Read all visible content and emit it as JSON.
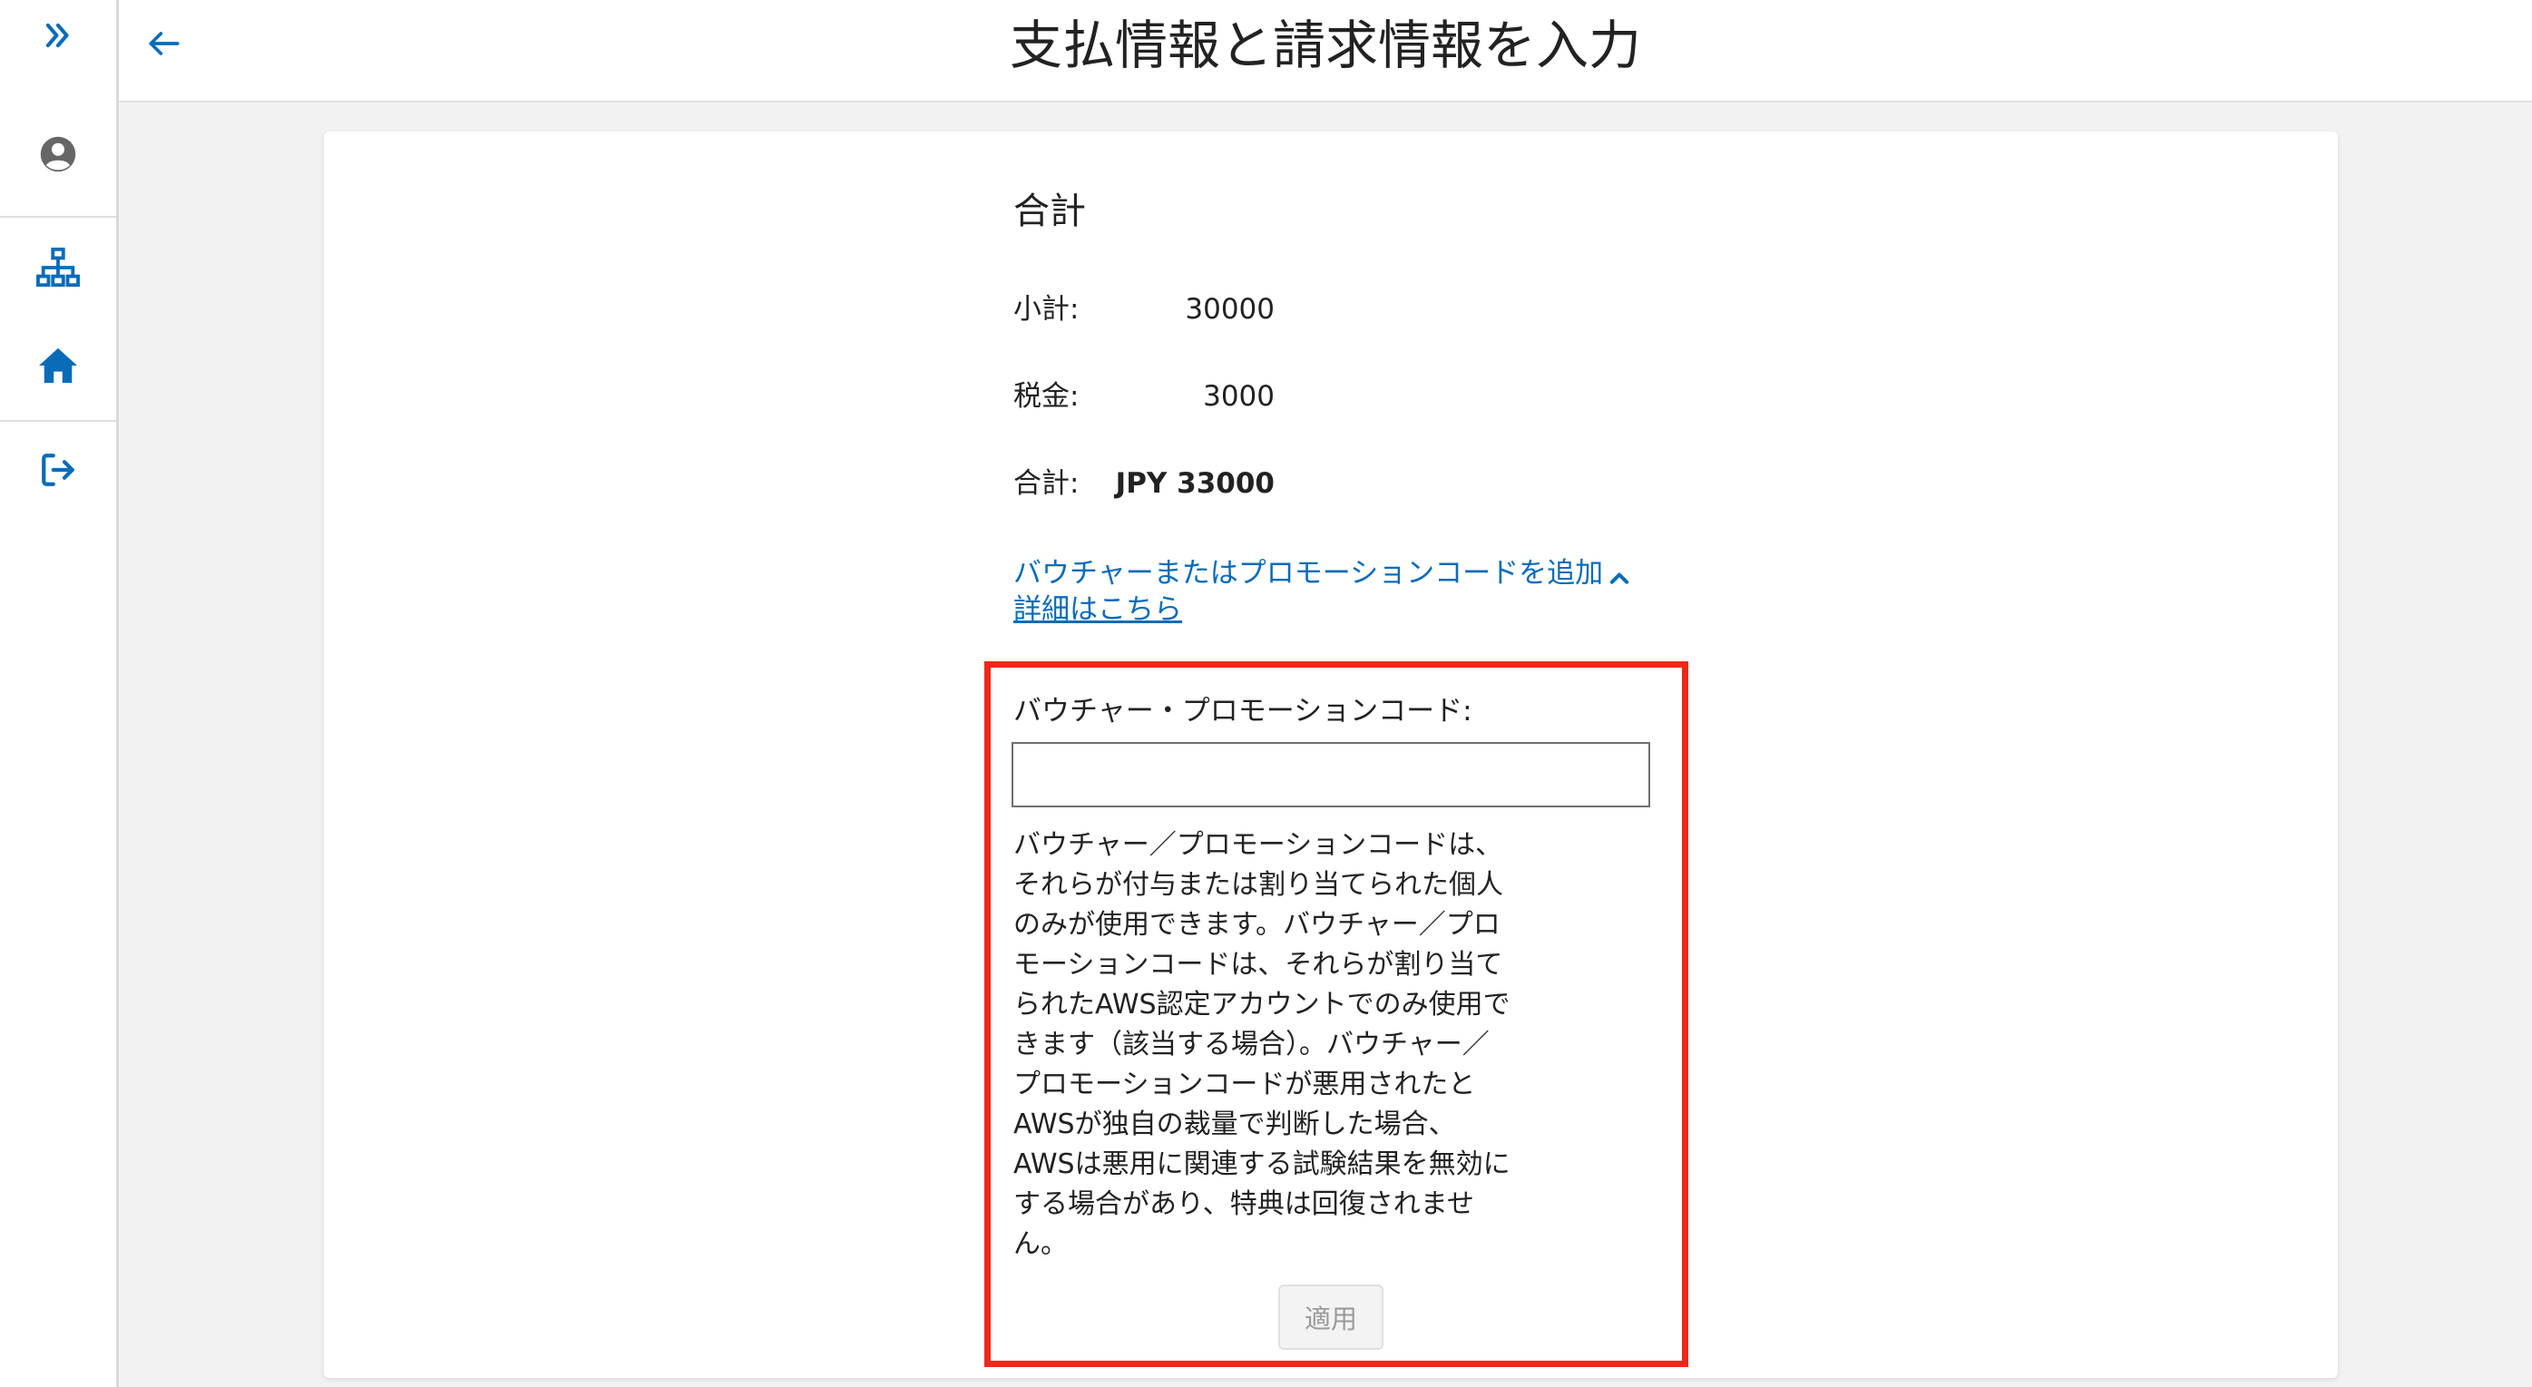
{
  "header": {
    "title": "支払情報と請求情報を入力"
  },
  "sidebar": {
    "icons": [
      "expand-icon",
      "user-account-icon",
      "sitemap-icon",
      "home-icon",
      "sign-out-icon"
    ]
  },
  "summary": {
    "heading": "合計",
    "subtotal_label": "小計:",
    "subtotal_value": "30000",
    "tax_label": "税金:",
    "tax_value": "3000",
    "total_label": "合計:",
    "total_value": "JPY 33000"
  },
  "voucher": {
    "toggle_link": "バウチャーまたはプロモーションコードを追加",
    "details_link": "詳細はこちら",
    "field_label": "バウチャー・プロモーションコード:",
    "field_value": "",
    "notice_lines": [
      "バウチャー／プロモーションコードは、",
      "それらが付与または割り当てられた個人",
      "のみが使用できます。バウチャー／プロ",
      "モーションコードは、それらが割り当て",
      "られたAWS認定アカウントでのみ使用で",
      "きます（該当する場合）。バウチャー／",
      "プロモーションコードが悪用されたと",
      "AWSが独自の裁量で判断した場合、",
      "AWSは悪用に関連する試験結果を無効に",
      "する場合があり、特典は回復されませ",
      "ん。"
    ],
    "apply_label": "適用"
  },
  "colors": {
    "accent": "#0a6bb8",
    "highlight": "#f0281a",
    "disabled_text": "#9a9a9a"
  }
}
